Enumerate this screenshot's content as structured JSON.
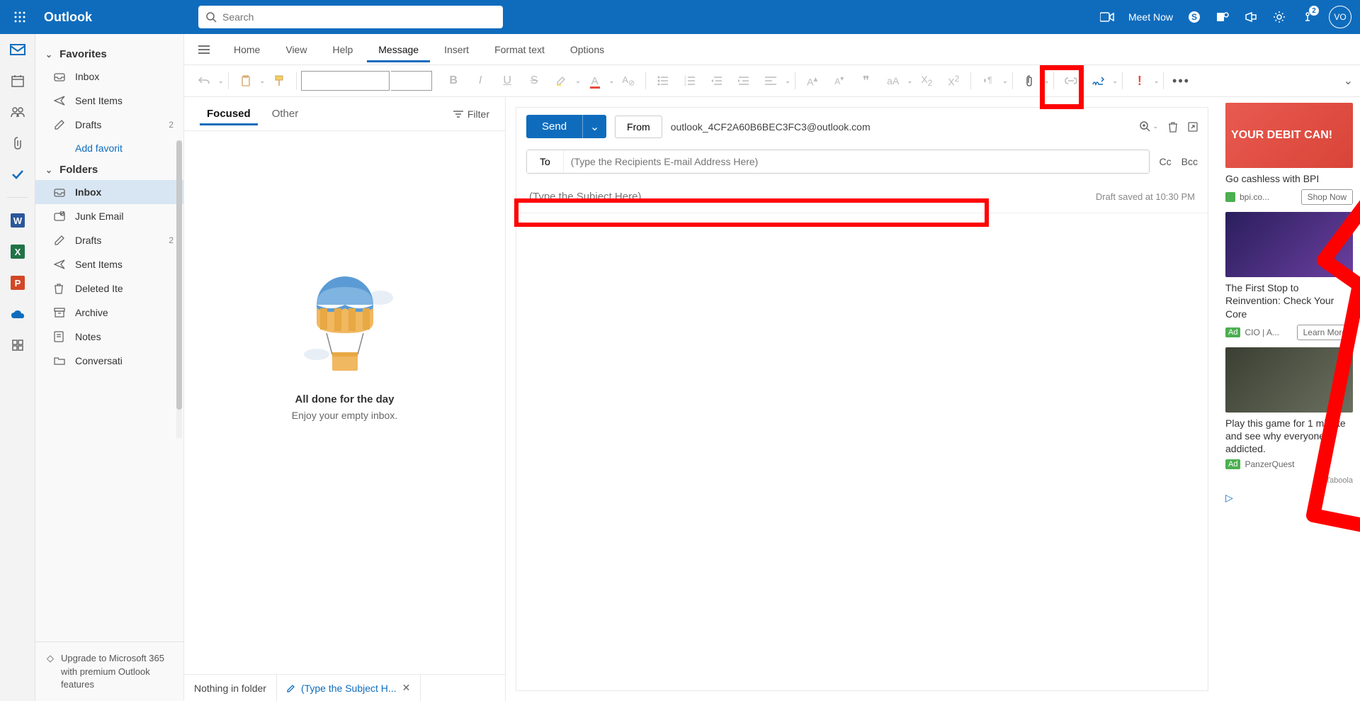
{
  "header": {
    "app_title": "Outlook",
    "search_placeholder": "Search",
    "meet_now": "Meet Now",
    "notif_count": "2",
    "avatar": "VO"
  },
  "menubar": {
    "items": [
      "Home",
      "View",
      "Help",
      "Message",
      "Insert",
      "Format text",
      "Options"
    ],
    "active_index": 3
  },
  "ribbon": {
    "font_name": "",
    "font_size": ""
  },
  "nav": {
    "favorites_label": "Favorites",
    "folders_label": "Folders",
    "add_favorite": "Add favorit",
    "favorites": [
      {
        "icon": "inbox",
        "label": "Inbox",
        "count": ""
      },
      {
        "icon": "sent",
        "label": "Sent Items",
        "count": ""
      },
      {
        "icon": "drafts",
        "label": "Drafts",
        "count": "2"
      }
    ],
    "folders": [
      {
        "icon": "inbox",
        "label": "Inbox",
        "count": "",
        "selected": true
      },
      {
        "icon": "junk",
        "label": "Junk Email",
        "count": ""
      },
      {
        "icon": "drafts",
        "label": "Drafts",
        "count": "2"
      },
      {
        "icon": "sent",
        "label": "Sent Items",
        "count": ""
      },
      {
        "icon": "deleted",
        "label": "Deleted Ite",
        "count": ""
      },
      {
        "icon": "archive",
        "label": "Archive",
        "count": ""
      },
      {
        "icon": "notes",
        "label": "Notes",
        "count": ""
      },
      {
        "icon": "conversation",
        "label": "Conversati",
        "count": ""
      }
    ],
    "upgrade": "Upgrade to Microsoft 365 with premium Outlook features"
  },
  "message_list": {
    "tabs": [
      "Focused",
      "Other"
    ],
    "active_tab": 0,
    "filter_label": "Filter",
    "empty_title": "All done for the day",
    "empty_sub": "Enjoy your empty inbox.",
    "bottom_tabs": [
      {
        "label": "Nothing in folder",
        "editing": false,
        "closeable": false
      },
      {
        "label": "(Type the Subject H...",
        "editing": true,
        "closeable": true
      }
    ]
  },
  "compose": {
    "send_label": "Send",
    "from_label": "From",
    "from_email": "outlook_4CF2A60B6BEC3FC3@outlook.com",
    "to_label": "To",
    "to_placeholder": "(Type the Recipients E-mail Address Here)",
    "cc_label": "Cc",
    "bcc_label": "Bcc",
    "subject_placeholder": "(Type the Subject Here)",
    "draft_stamp": "Draft saved at 10:30 PM"
  },
  "ads": [
    {
      "image_class": "red",
      "image_text": "YOUR DEBIT CAN!",
      "title": "Go cashless with BPI",
      "source": "bpi.co...",
      "cta": "Shop Now",
      "badge": ""
    },
    {
      "image_class": "purple",
      "image_text": "",
      "title": "The First Stop to Reinvention: Check Your Core",
      "source": "CIO | A...",
      "cta": "Learn More",
      "badge": "Ad"
    },
    {
      "image_class": "dark",
      "image_text": "",
      "title": "Play this game for 1 minute and see why everyone is addicted.",
      "source": "PanzerQuest",
      "cta": "",
      "badge": "Ad"
    }
  ],
  "taboola": "by Taboola"
}
